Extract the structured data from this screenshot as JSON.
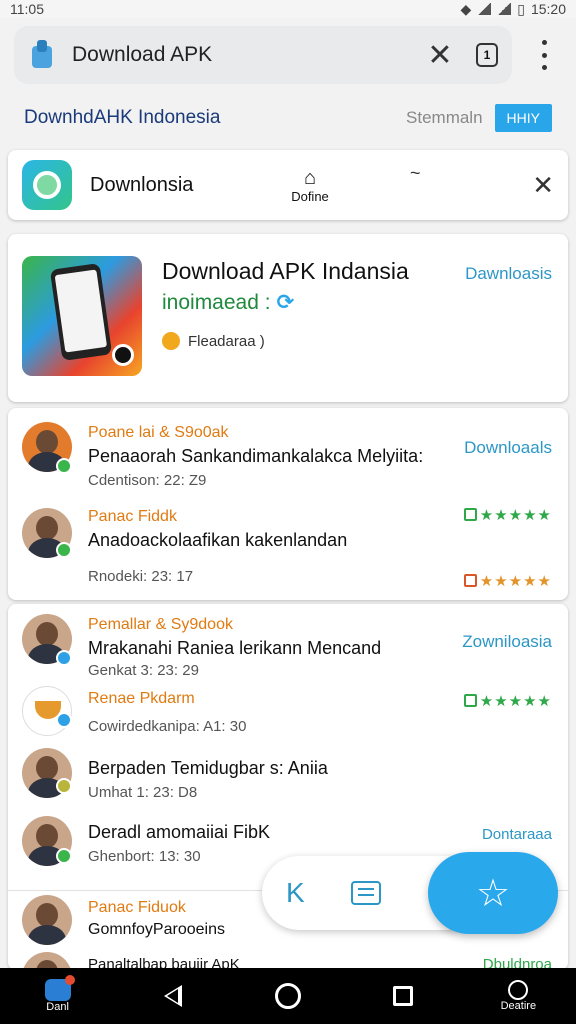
{
  "status": {
    "time": "11:05",
    "right_time": "15:20"
  },
  "browser": {
    "title": "Download APK",
    "tab_count": "1"
  },
  "site": {
    "title": "DownhdAHK Indonesia",
    "link": "Stemmaln",
    "button": "HHIY"
  },
  "app_row": {
    "name": "Downlonsia",
    "action": "Dofine",
    "tilde": "~"
  },
  "featured": {
    "title": "Download APK Indansia",
    "subtitle": "inoimaead :",
    "download": "Dawnloasis",
    "meta": "Fleadaraa )"
  },
  "list1": [
    {
      "name": "Poane lai & S9o0ak",
      "msg": "Penaaorah Sankandimankalakca Melyiita:",
      "time": "Cdentison: 22: Z9",
      "right": "Downloaals"
    },
    {
      "name": "Panac Fiddk",
      "msg": "Anadoackolaafikan kakenlandan",
      "time": "Rnodeki: 23: 17",
      "right": "★★★★★"
    }
  ],
  "list1_extra": {
    "right": "★★★★★"
  },
  "list2": [
    {
      "name": "Pemallar & Sy9dook",
      "msg": "Mrakanahi Raniea lerikann Mencand",
      "time": "Genkat 3: 23: 29",
      "right": "Zowniloasia"
    },
    {
      "name": "Renae Pkdarm",
      "msg": "Cowirdedkanipa: A1: 30",
      "time": "",
      "right": "★★★★★"
    },
    {
      "name": "",
      "msg": "Berpaden Temidugbar s: Aniia",
      "time": "Umhat 1: 23: D8",
      "right": ""
    },
    {
      "name": "",
      "msg": "Deradl amomaiiai FibK",
      "time": "Ghenbort: 13: 30",
      "right": "Dontaraaa"
    },
    {
      "name": "Panac Fiduok",
      "msg": "GomnfoyParooeins",
      "time": "",
      "right": ""
    },
    {
      "name": "",
      "msg": "Panaltalbap bauiir ApK",
      "time": "",
      "right": "Dbuldnroa"
    }
  ],
  "fab_bar": {
    "k": "K",
    "star": "☆"
  },
  "navbar": {
    "app_label": "Danl",
    "settings_label": "Deatire"
  }
}
